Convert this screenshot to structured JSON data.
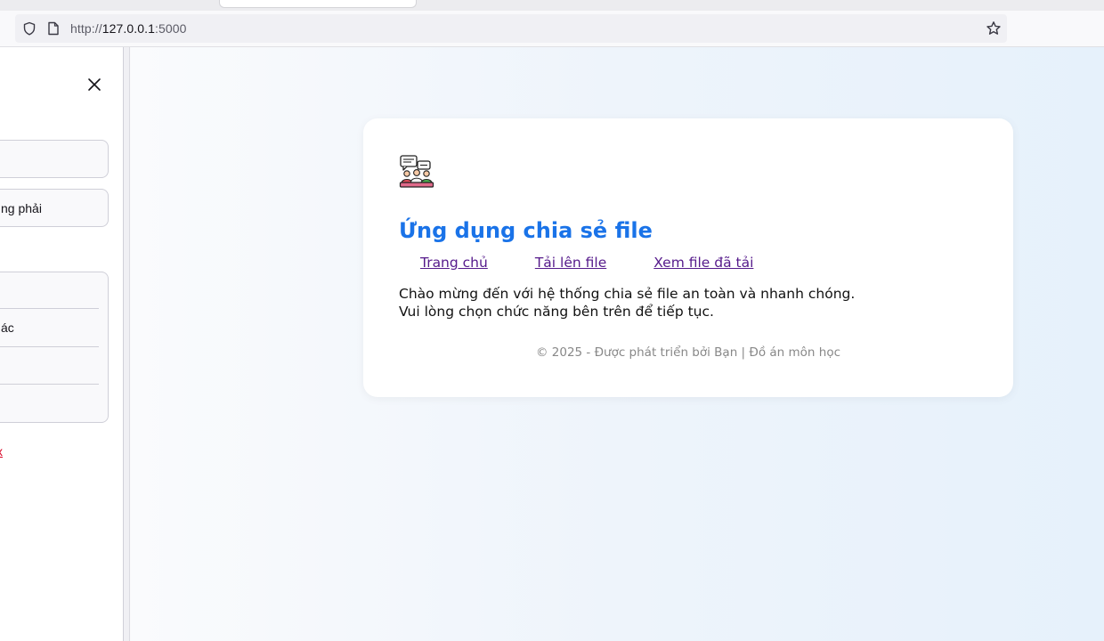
{
  "browser": {
    "url_scheme": "http://",
    "url_host": "127.0.0.1",
    "url_port": ":5000"
  },
  "sidebar": {
    "box2_text": "ng phải",
    "list_items": [
      "",
      "ác",
      "",
      ""
    ],
    "link_text": "x"
  },
  "app": {
    "title": "Ứng dụng chia sẻ file",
    "nav": {
      "home": "Trang chủ",
      "upload": "Tải lên file",
      "view": "Xem file đã tải"
    },
    "intro_line1": "Chào mừng đến với hệ thống chia sẻ file an toàn và nhanh chóng.",
    "intro_line2": "Vui lòng chọn chức năng bên trên để tiếp tục.",
    "footer": "© 2025 - Được phát triển bởi Bạn | Đồ án môn học"
  },
  "colors": {
    "title": "#1a73e8",
    "link": "#551a8b",
    "sidebar_link": "#d70022"
  },
  "icons": [
    "shield-icon",
    "page-icon",
    "star-icon",
    "close-icon",
    "people-chat-logo"
  ]
}
